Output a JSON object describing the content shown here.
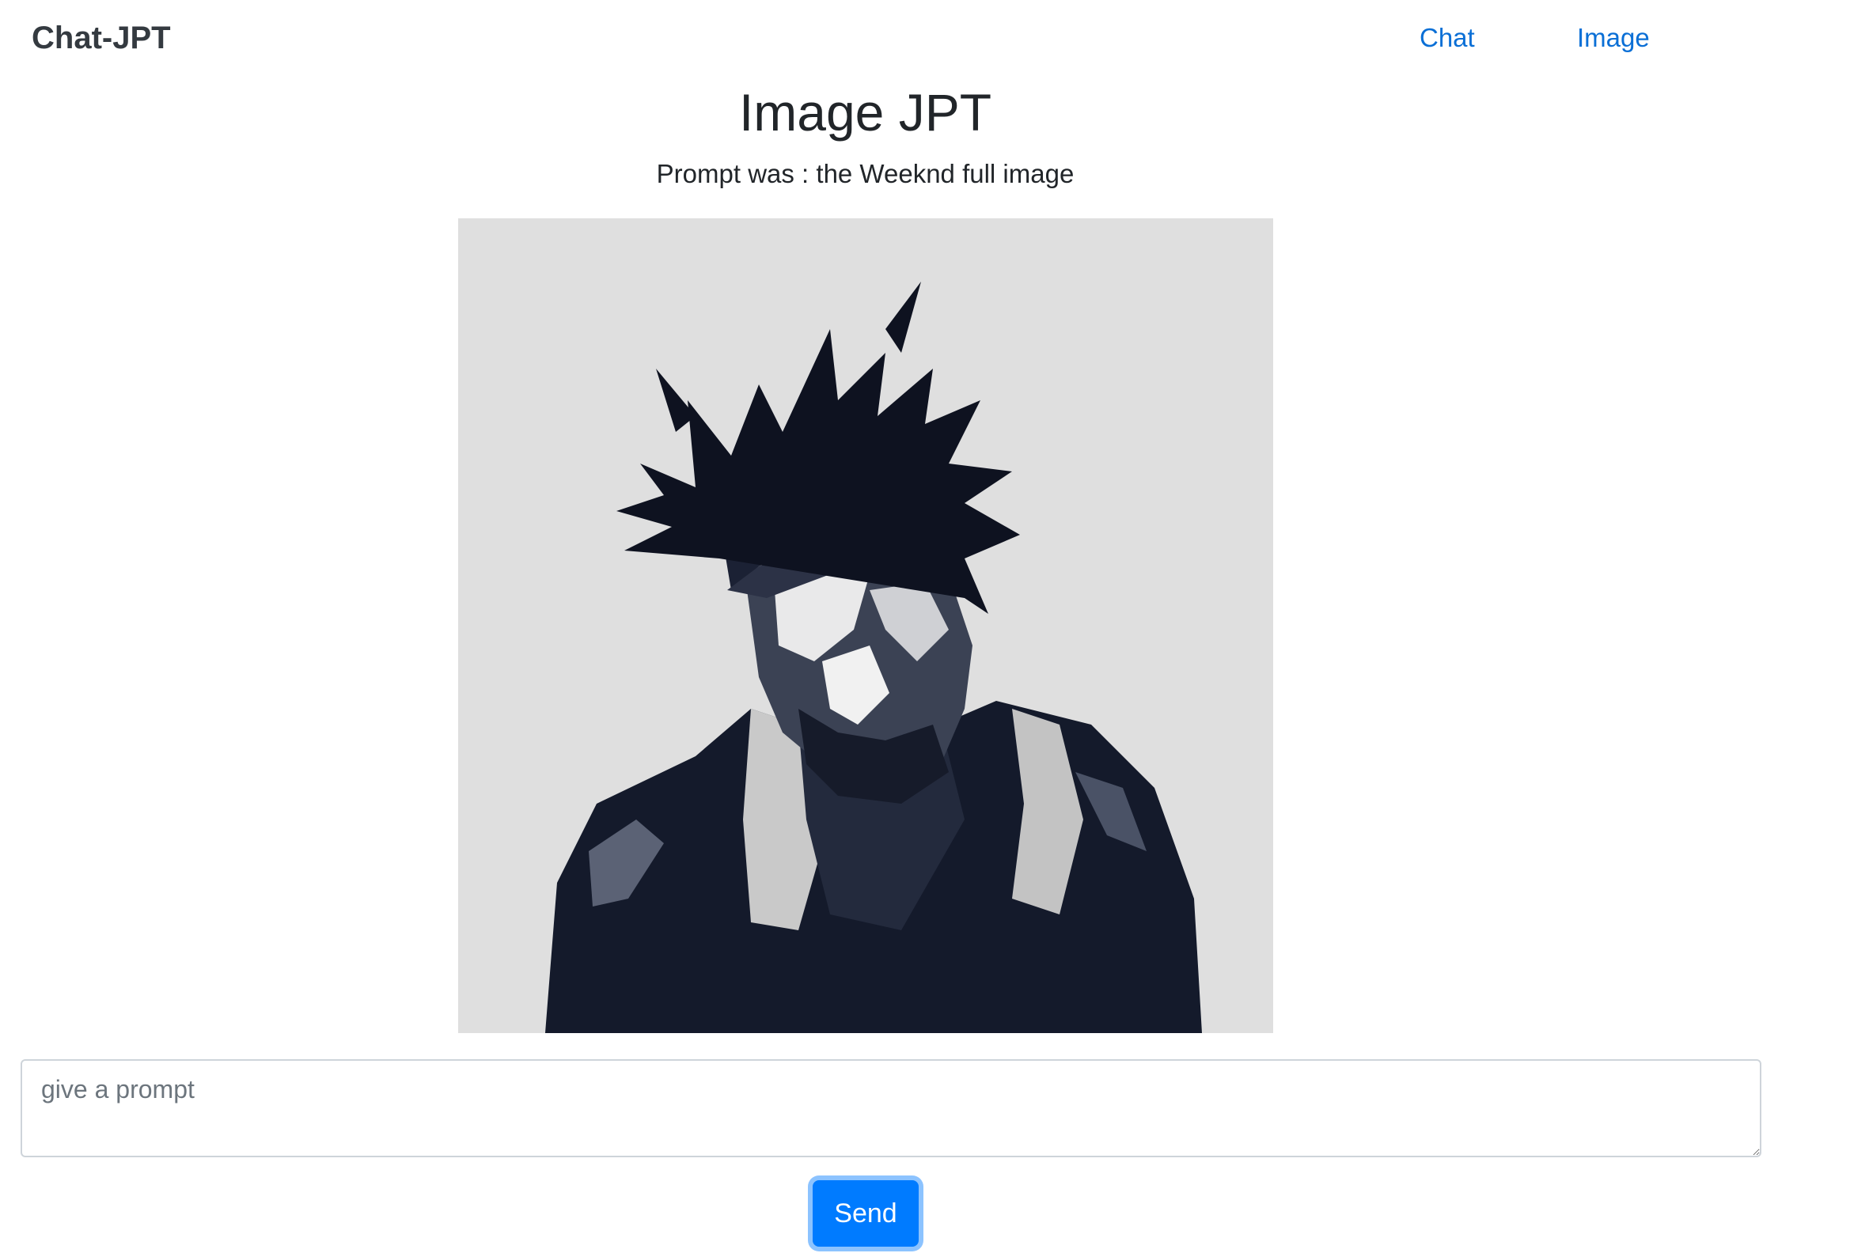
{
  "nav": {
    "brand": "Chat-JPT",
    "links": [
      {
        "label": "Chat"
      },
      {
        "label": "Image"
      }
    ],
    "link_color": "#0a6fd6"
  },
  "main": {
    "title": "Image JPT",
    "prompt_line": "Prompt was : the Weeknd full image",
    "image": {
      "background_color": "#e0e0e0",
      "figure_color": "#141a2b"
    }
  },
  "form": {
    "placeholder": "give a prompt",
    "value": "",
    "send_label": "Send",
    "button_color": "#007bff"
  }
}
